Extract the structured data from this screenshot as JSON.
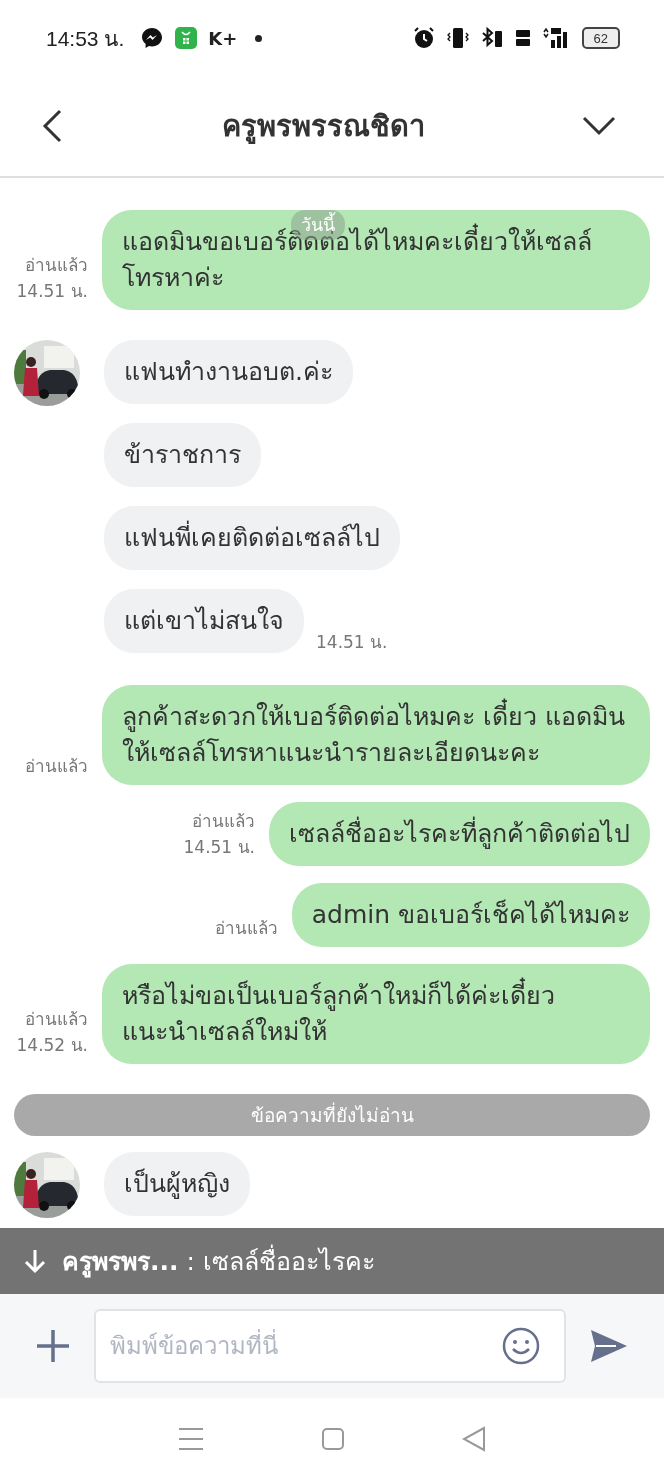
{
  "status_bar": {
    "time": "14:53 น.",
    "app_badge": "K+",
    "battery": "62"
  },
  "header": {
    "title": "ครูพรพรรณชิดา"
  },
  "date_pill": "วันนี้",
  "messages": [
    {
      "kind": "out",
      "text": "แอดมินขอเบอร์ติดต่อได้ไหมคะเดี๋ยวให้เซลล์โทรหาค่ะ",
      "read": "อ่านแล้ว",
      "time": "14.51 น."
    },
    {
      "kind": "in",
      "avatar": true,
      "text": "แฟนทำงานอบต.ค่ะ"
    },
    {
      "kind": "in",
      "avatar": false,
      "text": "ข้าราชการ"
    },
    {
      "kind": "in",
      "avatar": false,
      "text": "แฟนพี่เคยติดต่อเซลล์ไป"
    },
    {
      "kind": "in",
      "avatar": false,
      "text": "แต่เขาไม่สนใจ",
      "time": "14.51 น."
    },
    {
      "kind": "out",
      "text": "ลูกค้าสะดวกให้เบอร์ติดต่อไหมคะ เดี๋ยว แอดมิน ให้เซลล์โทรหาแนะนำรายละเอียดนะคะ",
      "read": "อ่านแล้ว"
    },
    {
      "kind": "out",
      "text": "เซลล์ชื่ออะไรคะที่ลูกค้าติดต่อไป",
      "read": "อ่านแล้ว",
      "time": "14.51 น."
    },
    {
      "kind": "out",
      "text": "admin ขอเบอร์เช็คได้ไหมคะ",
      "read": "อ่านแล้ว"
    },
    {
      "kind": "out",
      "text": "หรือไม่ขอเป็นเบอร์ลูกค้าใหม่ก็ได้ค่ะเดี๋ยวแนะนำเซลล์ใหม่ให้",
      "read": "อ่านแล้ว",
      "time": "14.52 น."
    },
    {
      "kind": "divider",
      "text": "ข้อความที่ยังไม่อ่าน"
    },
    {
      "kind": "in",
      "avatar": true,
      "text": "เป็นผู้หญิง"
    }
  ],
  "new_message_banner": {
    "sender": "ครูพรพร...",
    "separator": ":",
    "text": "เซลล์ชื่ออะไรคะ"
  },
  "composer": {
    "placeholder": "พิมพ์ข้อความที่นี่"
  }
}
